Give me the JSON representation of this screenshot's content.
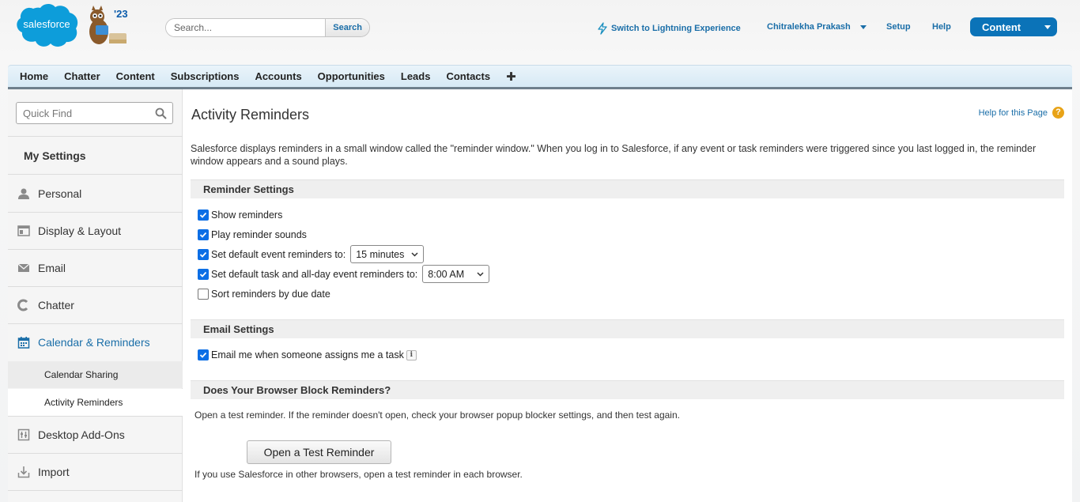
{
  "header": {
    "logo_text": "salesforce",
    "release_badge": "'23",
    "search": {
      "placeholder": "Search...",
      "button_label": "Search"
    },
    "lightning_link": "Switch to Lightning Experience",
    "user_name": "Chitralekha Prakash",
    "setup_link": "Setup",
    "help_link": "Help",
    "app_picker": "Content"
  },
  "tabs": [
    "Home",
    "Chatter",
    "Content",
    "Subscriptions",
    "Accounts",
    "Opportunities",
    "Leads",
    "Contacts"
  ],
  "sidebar": {
    "quick_find_placeholder": "Quick Find",
    "heading": "My Settings",
    "items": [
      {
        "label": "Personal",
        "icon": "person-icon"
      },
      {
        "label": "Display & Layout",
        "icon": "layout-icon"
      },
      {
        "label": "Email",
        "icon": "envelope-icon"
      },
      {
        "label": "Chatter",
        "icon": "chatter-icon"
      },
      {
        "label": "Calendar & Reminders",
        "icon": "calendar-icon",
        "active": true
      },
      {
        "label": "Desktop Add-Ons",
        "icon": "desktop-addons-icon"
      },
      {
        "label": "Import",
        "icon": "import-icon"
      }
    ],
    "sub_items": [
      {
        "label": "Calendar Sharing"
      },
      {
        "label": "Activity Reminders",
        "selected": true
      }
    ]
  },
  "main": {
    "title": "Activity Reminders",
    "help_link": "Help for this Page",
    "intro": "Salesforce displays reminders in a small window called the \"reminder window.\" When you log in to Salesforce, if any event or task reminders were triggered since you last logged in, the reminder window appears and a sound plays.",
    "reminder_settings": {
      "heading": "Reminder Settings",
      "show_reminders": {
        "label": "Show reminders",
        "checked": true
      },
      "play_sounds": {
        "label": "Play reminder sounds",
        "checked": true
      },
      "default_event": {
        "label": "Set default event reminders to:",
        "checked": true,
        "value": "15 minutes"
      },
      "default_task": {
        "label": "Set default task and all-day event reminders to:",
        "checked": true,
        "value": "8:00 AM"
      },
      "sort_due": {
        "label": "Sort reminders by due date",
        "checked": false
      }
    },
    "email_settings": {
      "heading": "Email Settings",
      "email_assign": {
        "label": "Email me when someone assigns me a task",
        "checked": true,
        "info": "i"
      }
    },
    "browser_block": {
      "heading": "Does Your Browser Block Reminders?",
      "instructions": "Open a test reminder. If the reminder doesn't open, check your browser popup blocker settings, and then test again.",
      "button_label": "Open a Test Reminder",
      "note": "If you use Salesforce in other browsers, open a test reminder in each browser."
    }
  },
  "colors": {
    "brand_blue": "#0b73b8",
    "link_blue": "#1a6ea8",
    "checkbox_blue": "#0b6ee5"
  }
}
